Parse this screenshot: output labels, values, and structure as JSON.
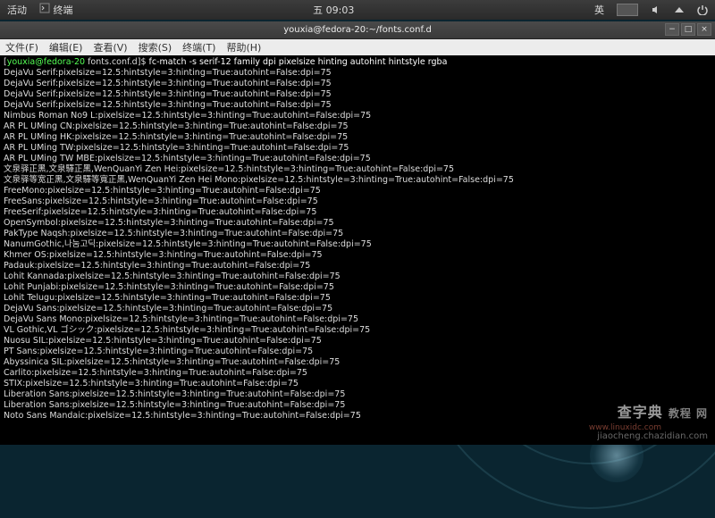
{
  "topbar": {
    "activities": "活动",
    "app": "终端",
    "clock": "五 09:03",
    "ime": "英"
  },
  "titlebar": {
    "title": "youxia@fedora-20:~/fonts.conf.d"
  },
  "menubar": {
    "file": "文件(F)",
    "edit": "编辑(E)",
    "view": "查看(V)",
    "search": "搜索(S)",
    "terminal": "终端(T)",
    "help": "帮助(H)"
  },
  "prompt": {
    "user_host": "youxia@fedora-20",
    "path": "fonts.conf.d",
    "command": "fc-match -s serif-12 family dpi pixelsize hinting autohint hintstyle rgba"
  },
  "lines": [
    "DejaVu Serif:pixelsize=12.5:hintstyle=3:hinting=True:autohint=False:dpi=75",
    "DejaVu Serif:pixelsize=12.5:hintstyle=3:hinting=True:autohint=False:dpi=75",
    "DejaVu Serif:pixelsize=12.5:hintstyle=3:hinting=True:autohint=False:dpi=75",
    "DejaVu Serif:pixelsize=12.5:hintstyle=3:hinting=True:autohint=False:dpi=75",
    "Nimbus Roman No9 L:pixelsize=12.5:hintstyle=3:hinting=True:autohint=False:dpi=75",
    "AR PL UMing CN:pixelsize=12.5:hintstyle=3:hinting=True:autohint=False:dpi=75",
    "AR PL UMing HK:pixelsize=12.5:hintstyle=3:hinting=True:autohint=False:dpi=75",
    "AR PL UMing TW:pixelsize=12.5:hintstyle=3:hinting=True:autohint=False:dpi=75",
    "AR PL UMing TW MBE:pixelsize=12.5:hintstyle=3:hinting=True:autohint=False:dpi=75",
    "文泉驿正黑,文泉驛正黑,WenQuanYi Zen Hei:pixelsize=12.5:hintstyle=3:hinting=True:autohint=False:dpi=75",
    "文泉驿等宽正黑,文泉驛等寬正黑,WenQuanYi Zen Hei Mono:pixelsize=12.5:hintstyle=3:hinting=True:autohint=False:dpi=75",
    "FreeMono:pixelsize=12.5:hintstyle=3:hinting=True:autohint=False:dpi=75",
    "FreeSans:pixelsize=12.5:hintstyle=3:hinting=True:autohint=False:dpi=75",
    "FreeSerif:pixelsize=12.5:hintstyle=3:hinting=True:autohint=False:dpi=75",
    "OpenSymbol:pixelsize=12.5:hintstyle=3:hinting=True:autohint=False:dpi=75",
    "PakType Naqsh:pixelsize=12.5:hintstyle=3:hinting=True:autohint=False:dpi=75",
    "NanumGothic,나눔고딕:pixelsize=12.5:hintstyle=3:hinting=True:autohint=False:dpi=75",
    "Khmer OS:pixelsize=12.5:hintstyle=3:hinting=True:autohint=False:dpi=75",
    "Padauk:pixelsize=12.5:hintstyle=3:hinting=True:autohint=False:dpi=75",
    "Lohit Kannada:pixelsize=12.5:hintstyle=3:hinting=True:autohint=False:dpi=75",
    "Lohit Punjabi:pixelsize=12.5:hintstyle=3:hinting=True:autohint=False:dpi=75",
    "Lohit Telugu:pixelsize=12.5:hintstyle=3:hinting=True:autohint=False:dpi=75",
    "DejaVu Sans:pixelsize=12.5:hintstyle=3:hinting=True:autohint=False:dpi=75",
    "DejaVu Sans Mono:pixelsize=12.5:hintstyle=3:hinting=True:autohint=False:dpi=75",
    "VL Gothic,VL ゴシック:pixelsize=12.5:hintstyle=3:hinting=True:autohint=False:dpi=75",
    "Nuosu SIL:pixelsize=12.5:hintstyle=3:hinting=True:autohint=False:dpi=75",
    "PT Sans:pixelsize=12.5:hintstyle=3:hinting=True:autohint=False:dpi=75",
    "Abyssinica SIL:pixelsize=12.5:hintstyle=3:hinting=True:autohint=False:dpi=75",
    "Carlito:pixelsize=12.5:hintstyle=3:hinting=True:autohint=False:dpi=75",
    "STIX:pixelsize=12.5:hintstyle=3:hinting=True:autohint=False:dpi=75",
    "Liberation Sans:pixelsize=12.5:hintstyle=3:hinting=True:autohint=False:dpi=75",
    "Liberation Sans:pixelsize=12.5:hintstyle=3:hinting=True:autohint=False:dpi=75",
    "Noto Sans Mandaic:pixelsize=12.5:hintstyle=3:hinting=True:autohint=False:dpi=75"
  ],
  "watermark": {
    "main": "查字典",
    "sub": "教程 网",
    "url": "jiaocheng.chazidian.com",
    "small": "www.linuxidc.com"
  }
}
